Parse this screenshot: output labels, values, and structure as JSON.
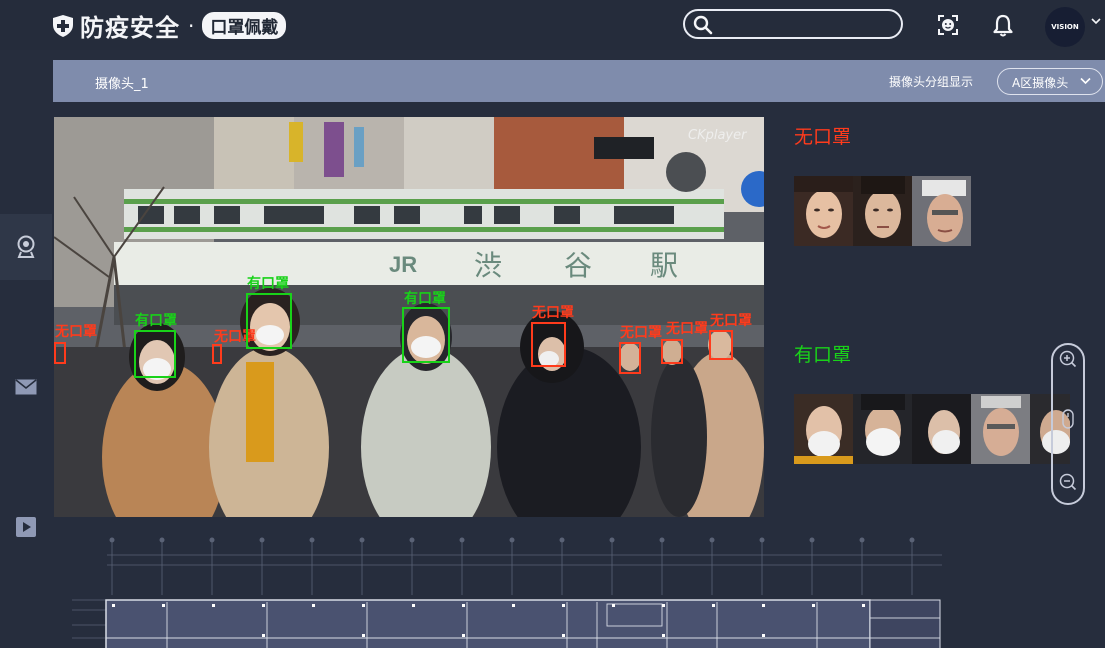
{
  "header": {
    "brand_title": "防疫安全",
    "brand_separator": "·",
    "brand_subtitle": "口罩佩戴",
    "search_placeholder": "",
    "avatar_text": "VISION",
    "icons": [
      "shield-plus-icon",
      "search-icon",
      "face-scan-icon",
      "bell-icon",
      "chevron-down-icon"
    ]
  },
  "sidebar": {
    "items": [
      {
        "icon": "camera-icon",
        "active": true
      },
      {
        "icon": "mail-icon",
        "active": false
      },
      {
        "icon": "play-icon",
        "active": false
      }
    ]
  },
  "toolbar": {
    "camera_name": "摄像头_1",
    "group_label": "摄像头分组显示",
    "group_value": "A区摄像头"
  },
  "video": {
    "watermark": "CKplayer",
    "detections": [
      {
        "label": "无口罩",
        "type": "no-mask"
      },
      {
        "label": "有口罩",
        "type": "mask"
      },
      {
        "label": "无口罩",
        "type": "no-mask"
      },
      {
        "label": "有口罩",
        "type": "mask"
      },
      {
        "label": "有口罩",
        "type": "mask"
      },
      {
        "label": "无口罩",
        "type": "no-mask"
      },
      {
        "label": "无口罩",
        "type": "no-mask"
      },
      {
        "label": "无口罩",
        "type": "no-mask"
      },
      {
        "label": "无口罩",
        "type": "no-mask"
      }
    ],
    "station_sign": [
      "JR",
      "渋",
      "谷",
      "駅"
    ]
  },
  "panel": {
    "no_mask_title": "无口罩",
    "mask_title": "有口罩",
    "no_mask_count": 3,
    "mask_count": 5
  },
  "colors": {
    "no_mask": "#ff3b1c",
    "mask": "#19d219",
    "background": "#262d3d",
    "toolbar": "#7f8cac"
  }
}
